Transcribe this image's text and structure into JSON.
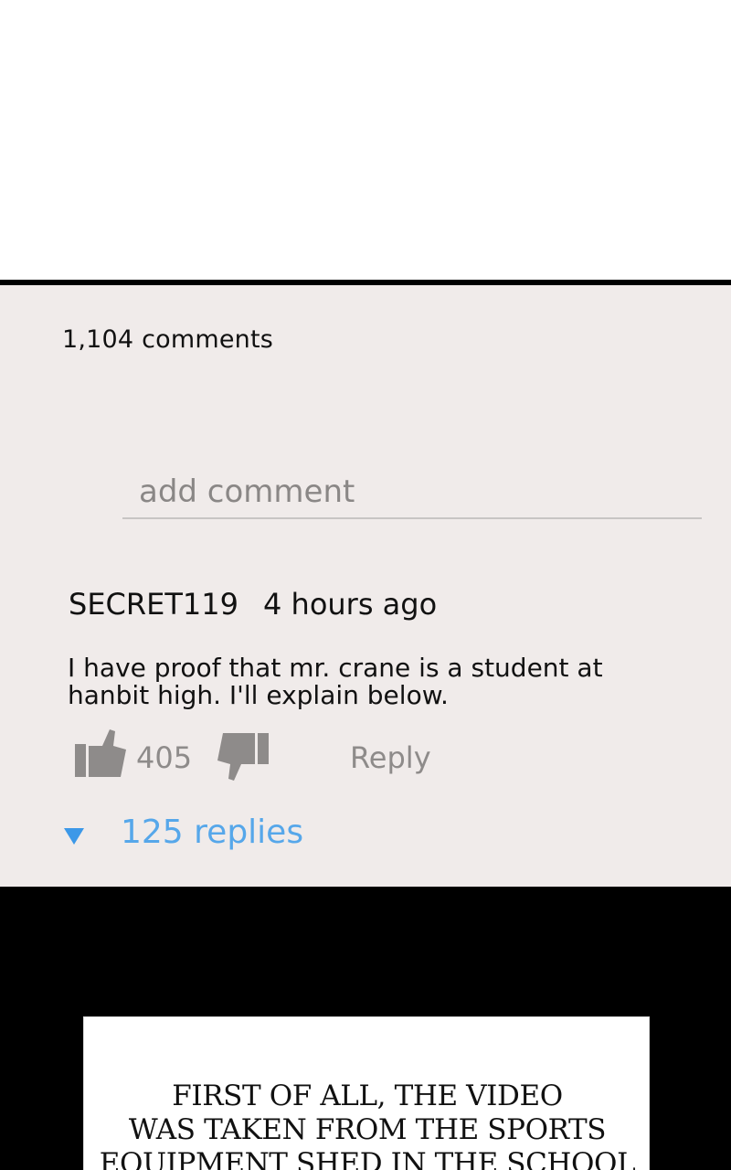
{
  "comments_header": {
    "count_label": "1,104 comments"
  },
  "comment_input": {
    "placeholder": "add comment"
  },
  "comment": {
    "username": "SECRET119",
    "timestamp": "4 hours ago",
    "body": "I have proof that mr. crane is a student at hanbit high. I'll explain below.",
    "likes": "405",
    "reply_label": "Reply",
    "replies_label": "125 replies"
  },
  "caption": {
    "lines": [
      "FIRST OF ALL, THE VIDEO",
      "WAS TAKEN FROM THE SPORTS",
      "EQUIPMENT SHED IN THE SCHOOL"
    ]
  },
  "icons": {
    "like": "thumbs-up-icon",
    "dislike": "thumbs-down-icon",
    "expand": "triangle-down-icon"
  },
  "colors": {
    "panel_bg": "#f0ebea",
    "link_blue": "#56a7ea",
    "muted_gray": "#8e8b8a"
  }
}
